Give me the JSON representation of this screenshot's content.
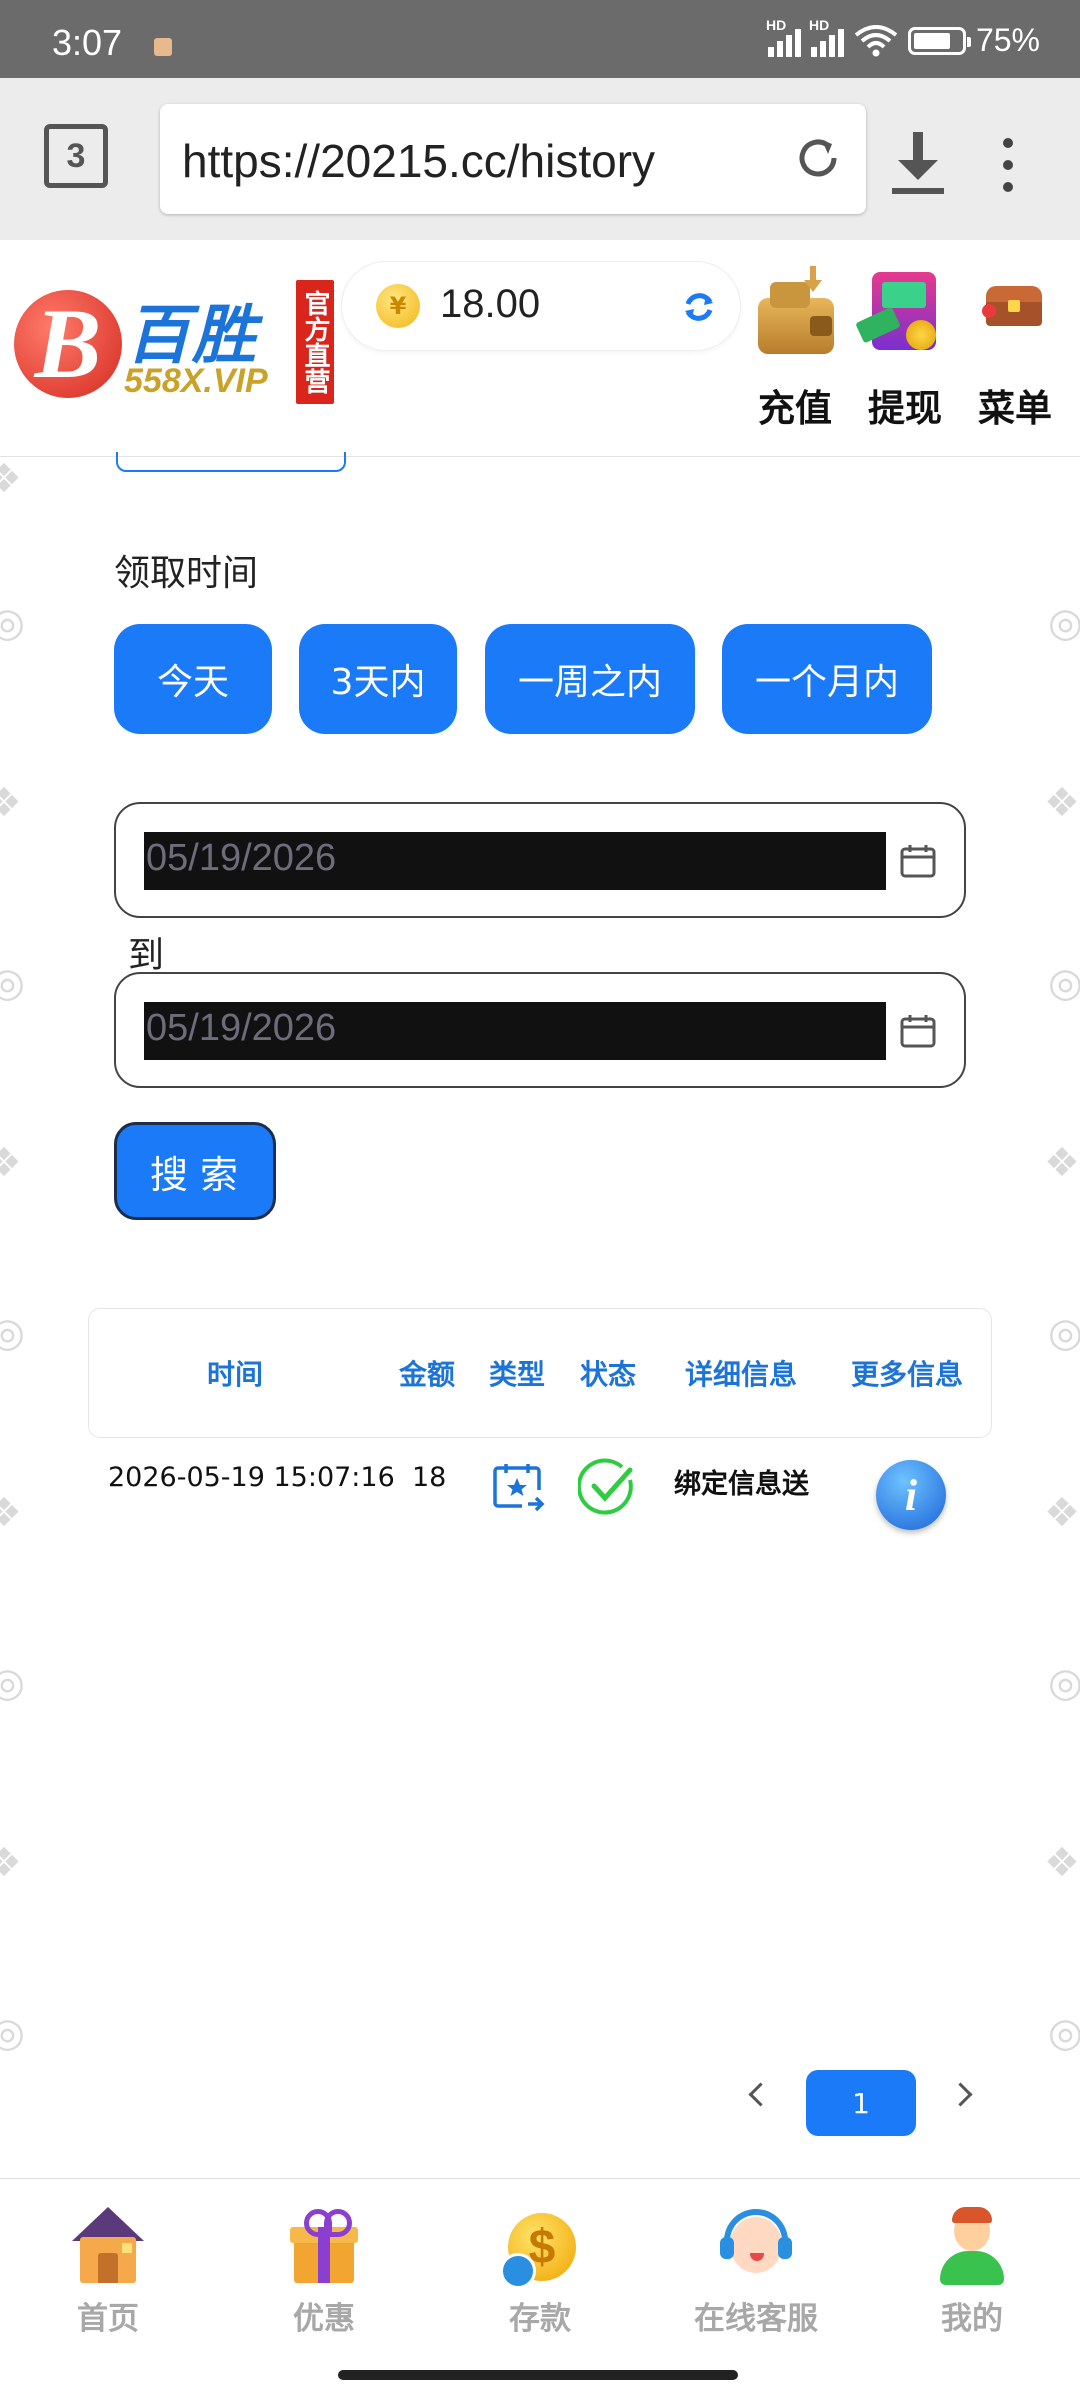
{
  "status_bar": {
    "time": "3:07",
    "network_label": "HD",
    "battery": "75%"
  },
  "browser": {
    "tab_count": "3",
    "url": "https://20215.cc/history"
  },
  "header": {
    "logo_mark": "B",
    "logo_name": "百胜",
    "logo_domain": "558X.VIP",
    "logo_tag": "官方直营",
    "coin_symbol": "¥",
    "balance": "18.00",
    "actions": {
      "recharge": "充值",
      "withdraw": "提现",
      "menu": "菜单"
    }
  },
  "filter": {
    "label": "领取时间",
    "quick": [
      "今天",
      "3天内",
      "一周之内",
      "一个月内"
    ],
    "date_from": "05/19/2026",
    "to_label": "到",
    "date_to": "05/19/2026",
    "search_label": "搜索"
  },
  "table": {
    "headers": [
      "时间",
      "金额",
      "类型",
      "状态",
      "详细信息",
      "更多信息"
    ],
    "rows": [
      {
        "time": "2026-05-19 15:07:16",
        "amount": "18",
        "type_icon": "calendar-star-icon",
        "status_icon": "check-circle-icon",
        "detail": "绑定信息送",
        "more_icon": "info-icon"
      }
    ]
  },
  "pagination": {
    "current": "1"
  },
  "bottom_nav": [
    "首页",
    "优惠",
    "存款",
    "在线客服",
    "我的"
  ],
  "colors": {
    "primary": "#1a7af8",
    "brand_blue": "#1d74d8",
    "brand_red": "#d9251c",
    "success": "#2ecc40"
  }
}
